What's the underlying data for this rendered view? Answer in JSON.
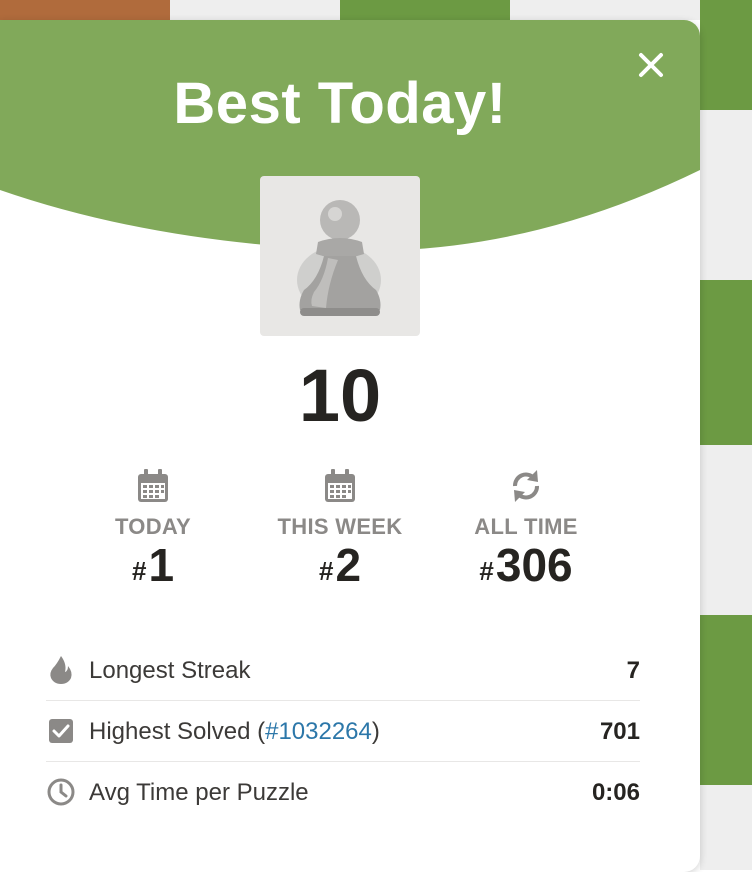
{
  "colors": {
    "header_green": "#81a95a",
    "board_green": "#6c9a43",
    "board_brown": "#b06b3c",
    "board_light": "#eeeeee",
    "link_blue": "#2c77a9"
  },
  "modal": {
    "title": "Best Today!",
    "close_icon": "close-icon",
    "piece_icon": "pawn-icon",
    "score": "10"
  },
  "stats": [
    {
      "icon": "calendar-icon",
      "label": "TODAY",
      "hash": "#",
      "rank": "1"
    },
    {
      "icon": "calendar-icon",
      "label": "THIS WEEK",
      "hash": "#",
      "rank": "2"
    },
    {
      "icon": "refresh-icon",
      "label": "ALL TIME",
      "hash": "#",
      "rank": "306"
    }
  ],
  "rows": {
    "streak": {
      "icon": "flame-icon",
      "label": "Longest Streak",
      "value": "7"
    },
    "highest": {
      "icon": "checkbox-icon",
      "label_prefix": "Highest Solved (",
      "link": "#1032264",
      "label_suffix": ")",
      "value": "701"
    },
    "avg": {
      "icon": "clock-icon",
      "label": "Avg Time per Puzzle",
      "value": "0:06"
    }
  }
}
